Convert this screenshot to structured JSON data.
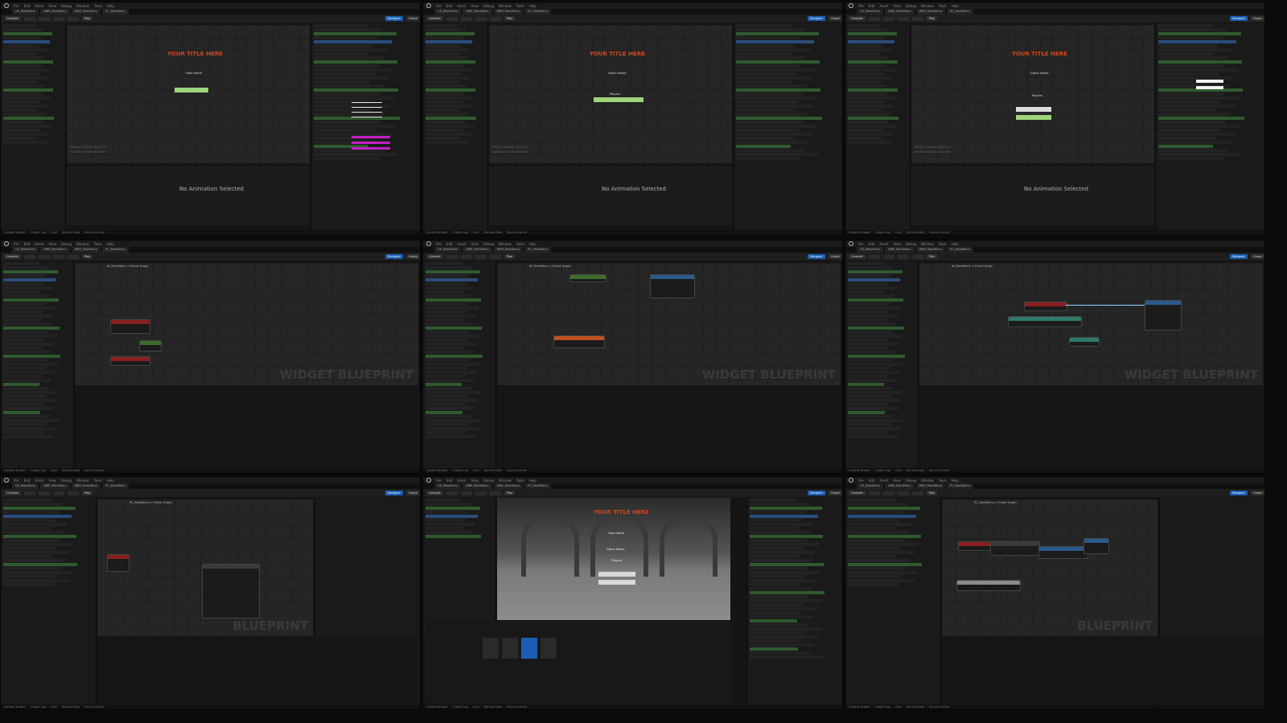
{
  "menu": [
    "File",
    "Edit",
    "Asset",
    "View",
    "Debug",
    "Window",
    "Tools",
    "Help"
  ],
  "tabs": [
    "UE_MainMenu",
    "WBP_MainMenu",
    "WBP_MainMenu",
    "PC_MainMenu"
  ],
  "toolbar": {
    "compile": "Compile",
    "play": "Play",
    "designer": "Designer",
    "graph": "Graph"
  },
  "panels": {
    "p1": {
      "title_text": "YOUR TITLE HERE",
      "subtitle": "Host Game",
      "no_anim": "No Animation Selected",
      "info1": "Device Content Scale 1.0",
      "info2": "No Device Safe Zone Set"
    },
    "p2": {
      "title_text": "YOUR TITLE HERE",
      "subtitle": "Game Name",
      "label2": "Players",
      "no_anim": "No Animation Selected",
      "info1": "Device Content Scale 1.0",
      "info2": "No Device Safe Zone Set"
    },
    "p3": {
      "title_text": "YOUR TITLE HERE",
      "subtitle": "Game Name",
      "label2": "Players",
      "no_anim": "No Animation Selected",
      "info1": "Device Content Scale 1.0",
      "info2": "No Device Safe Zone Set"
    },
    "p4": {
      "watermark": "WIDGET BLUEPRINT",
      "breadcrumb": "W_MainMenu > Event Graph"
    },
    "p5": {
      "watermark": "WIDGET BLUEPRINT",
      "breadcrumb": "W_MainMenu > Event Graph"
    },
    "p6": {
      "watermark": "WIDGET BLUEPRINT",
      "breadcrumb": "W_MainMenu > Event Graph"
    },
    "p7": {
      "watermark": "BLUEPRINT",
      "breadcrumb": "PC_MainMenu > Event Graph"
    },
    "p8": {
      "title_text": "YOUR TITLE HERE",
      "subtitle": "Host Game",
      "label2": "Game Name",
      "label3": "Players"
    },
    "p9": {
      "watermark": "BLUEPRINT",
      "breadcrumb": "PC_MainMenu > Event Graph"
    }
  },
  "status": [
    "Content Drawer",
    "Output Log",
    "Cmd",
    "Derived Data",
    "Source Control"
  ],
  "colors": {
    "title": "#d2471c",
    "accent": "#1a5fb4",
    "green": "#9fd47a",
    "magenta": "#c21fc4"
  }
}
